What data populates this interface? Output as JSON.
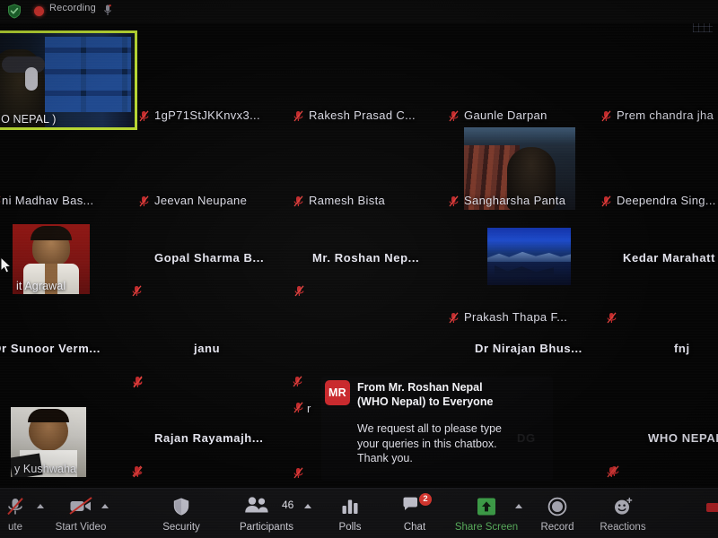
{
  "app": {
    "name": "Zoom Meeting",
    "view": "gallery"
  },
  "topbar": {
    "encryption_icon": "shield-check-icon",
    "recording_label": "Recording",
    "recording_dot": "record-dot-icon",
    "mic_icon": "microphone-icon"
  },
  "colors": {
    "active_speaker_border": "#b6d532",
    "recording_red": "#d5342f",
    "muted_icon_red": "#c0282a",
    "share_green": "#3fa34a",
    "chat_badge_red": "#d7362f",
    "toolbar_bg": "#121214",
    "background": "#000000"
  },
  "participants": [
    {
      "name": "( WHO NEPAL )",
      "display": "HO NEPAL )",
      "type": "video",
      "active_speaker": true,
      "muted": false
    },
    {
      "name": "1gP71StJKKnvx3...",
      "type": "audio",
      "muted": true
    },
    {
      "name": "Rakesh Prasad C...",
      "type": "audio",
      "muted": true
    },
    {
      "name": "Gaunle Darpan",
      "type": "audio",
      "muted": true
    },
    {
      "name": "Prem chandra jha",
      "type": "audio",
      "muted": true
    },
    {
      "name": "ni Madhav Bas...",
      "type": "audio",
      "muted": true
    },
    {
      "name": "Jeevan Neupane",
      "type": "audio",
      "muted": true
    },
    {
      "name": "Ramesh Bista",
      "type": "audio",
      "muted": true
    },
    {
      "name": "Sangharsha Panta",
      "type": "video",
      "muted": true
    },
    {
      "name": "Deependra Sing...",
      "type": "audio",
      "muted": true
    },
    {
      "name": "it Agrawal",
      "type": "video",
      "muted": false
    },
    {
      "name": "Gopal Sharma B...",
      "type": "audio",
      "muted": true
    },
    {
      "name": "Mr. Roshan Nep...",
      "type": "audio",
      "muted": true
    },
    {
      "name": "Prakash Thapa F...",
      "type": "video",
      "muted": true
    },
    {
      "name": "Kedar Marahatt",
      "type": "audio",
      "muted": true
    },
    {
      "name": "Dr Sunoor Verm...",
      "type": "audio",
      "muted": true
    },
    {
      "name": "janu",
      "type": "audio",
      "muted": true
    },
    {
      "name": "Dr Nirajan Bhus...",
      "type": "audio",
      "muted": true
    },
    {
      "name": "fnj",
      "type": "audio",
      "muted": true
    },
    {
      "name": "y Kushwaha",
      "type": "video",
      "muted": true
    },
    {
      "name": "Rajan Rayamajh...",
      "type": "audio",
      "muted": true
    },
    {
      "name": "r",
      "type": "audio",
      "muted": true
    },
    {
      "name": "DG",
      "type": "audio",
      "muted": true
    },
    {
      "name": "WHO NEPAL",
      "type": "audio",
      "muted": true
    }
  ],
  "chat_toast": {
    "avatar_initials": "MR",
    "from_line": "From Mr. Roshan Nepal (WHO Nepal) to Everyone",
    "from_line_1": "From Mr. Roshan Nepal",
    "from_line_2": "(WHO Nepal) to Everyone",
    "message": "We request all to please type your queries in this chatbox. Thank you."
  },
  "toolbar": [
    {
      "id": "mute",
      "label": "ute",
      "icon": "microphone-muted-icon",
      "caret": true,
      "badge": null,
      "count": null
    },
    {
      "id": "start-video",
      "label": "Start Video",
      "icon": "video-off-icon",
      "caret": true,
      "badge": null,
      "count": null
    },
    {
      "id": "security",
      "label": "Security",
      "icon": "shield-icon",
      "caret": false,
      "badge": null,
      "count": null
    },
    {
      "id": "participants",
      "label": "Participants",
      "icon": "participants-icon",
      "caret": true,
      "badge": null,
      "count": "46"
    },
    {
      "id": "polls",
      "label": "Polls",
      "icon": "bar-chart-icon",
      "caret": false,
      "badge": null,
      "count": null
    },
    {
      "id": "chat",
      "label": "Chat",
      "icon": "chat-bubble-icon",
      "caret": false,
      "badge": "2",
      "count": null
    },
    {
      "id": "share-screen",
      "label": "Share Screen",
      "icon": "share-screen-icon",
      "caret": true,
      "badge": null,
      "count": null
    },
    {
      "id": "record",
      "label": "Record",
      "icon": "record-circle-icon",
      "caret": false,
      "badge": null,
      "count": null
    },
    {
      "id": "reactions",
      "label": "Reactions",
      "icon": "smiley-plus-icon",
      "caret": false,
      "badge": null,
      "count": null
    }
  ]
}
